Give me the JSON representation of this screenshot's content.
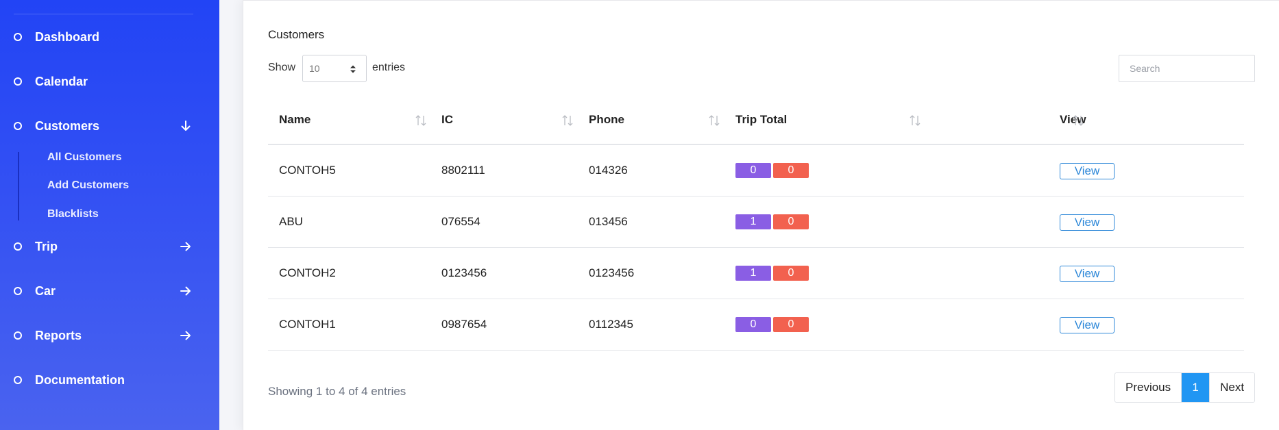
{
  "sidebar": {
    "items": [
      {
        "label": "Dashboard",
        "arrow": ""
      },
      {
        "label": "Calendar",
        "arrow": ""
      },
      {
        "label": "Customers",
        "arrow": "down"
      },
      {
        "label": "Trip",
        "arrow": "right"
      },
      {
        "label": "Car",
        "arrow": "right"
      },
      {
        "label": "Reports",
        "arrow": "right"
      },
      {
        "label": "Documentation",
        "arrow": ""
      }
    ],
    "customers_submenu": [
      "All Customers",
      "Add Customers",
      "Blacklists"
    ]
  },
  "card": {
    "title": "Customers",
    "show_label": "Show",
    "entries_label": "entries",
    "page_length": "10",
    "search_placeholder": "Search"
  },
  "table": {
    "columns": [
      "Name",
      "IC",
      "Phone",
      "Trip Total",
      "View"
    ],
    "rows": [
      {
        "name": "CONTOH5",
        "ic": "8802111",
        "phone": "014326",
        "trip_a": "0",
        "trip_b": "0",
        "view": "View"
      },
      {
        "name": "ABU",
        "ic": "076554",
        "phone": "013456",
        "trip_a": "1",
        "trip_b": "0",
        "view": "View"
      },
      {
        "name": "CONTOH2",
        "ic": "0123456",
        "phone": "0123456",
        "trip_a": "1",
        "trip_b": "0",
        "view": "View"
      },
      {
        "name": "CONTOH1",
        "ic": "0987654",
        "phone": "0112345",
        "trip_a": "0",
        "trip_b": "0",
        "view": "View"
      }
    ]
  },
  "footer": {
    "info": "Showing 1 to 4 of 4 entries",
    "previous": "Previous",
    "current_page": "1",
    "next": "Next"
  },
  "colors": {
    "sidebar_top": "#2244f5",
    "sidebar_bottom": "#4a63ef",
    "badge_purple": "#8a5ee4",
    "badge_red": "#f2614f",
    "link_blue": "#2c87d8",
    "pager_active": "#2196f3"
  }
}
